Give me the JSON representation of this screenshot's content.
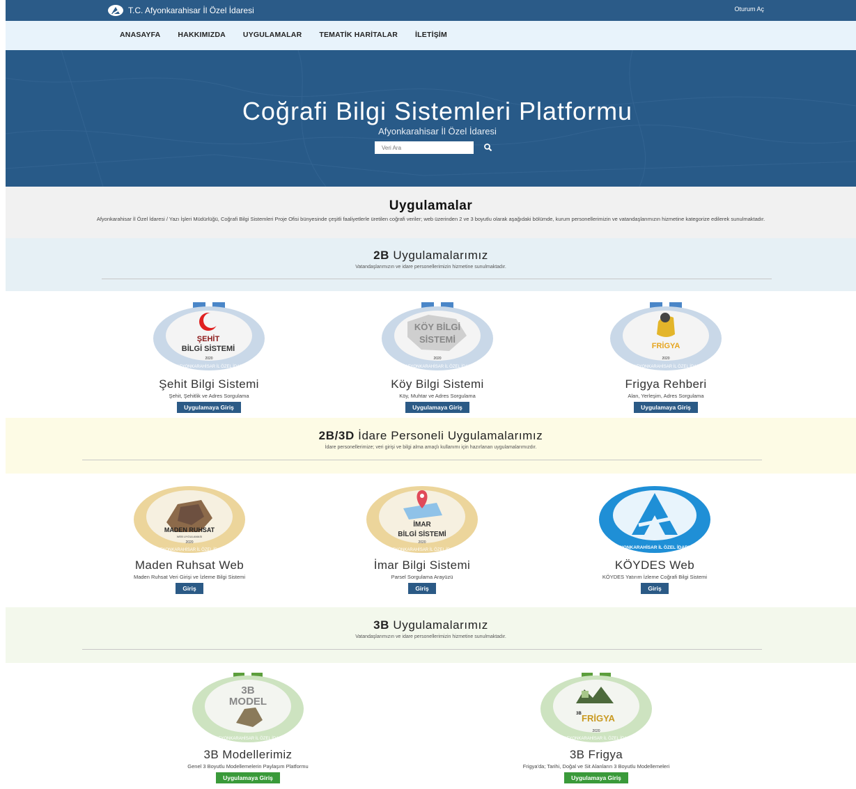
{
  "topbar": {
    "brand": "T.C. Afyonkarahisar İl Özel İdaresi",
    "login": "Oturum Aç"
  },
  "nav": [
    "ANASAYFA",
    "HAKKIMIZDA",
    "UYGULAMALAR",
    "TEMATİK HARİTALAR",
    "İLETİŞİM"
  ],
  "hero": {
    "title": "Coğrafi Bilgi Sistemleri Platformu",
    "subtitle": "Afyonkarahisar İl Özel İdaresi",
    "search_placeholder": "Veri Ara"
  },
  "apps": {
    "title": "Uygulamalar",
    "description": "Afyonkarahisar İl Özel İdaresi / Yazı İşleri Müdürlüğü, Coğrafi Bilgi Sistemleri Proje Ofisi bünyesinde çeşitli faaliyetlerle üretilen coğrafi veriler; web üzerinden 2 ve 3 boyutlu olarak aşağıdaki bölümde, kurum personellerimizin ve vatandaşlarımızın hizmetine kategorize edilerek sunulmaktadır."
  },
  "section_2b": {
    "title_bold": "2B",
    "title_rest": " Uygulamalarımız",
    "subtitle": "Vatandaşlarımızın ve idare personellerimizin hizmetine sunulmaktadır.",
    "cards": [
      {
        "title": "Şehit Bilgi Sistemi",
        "desc": "Şehit, Şehitlik ve Adres Sorgulama",
        "button": "Uygulamaya Giriş",
        "badge_line1": "ŞEHİT",
        "badge_line2": "BİLGİ SİSTEMİ",
        "ring": "T.C. AFYONKARAHİSAR İL ÖZEL İDARESİ",
        "year": "2020"
      },
      {
        "title": "Köy Bilgi Sistemi",
        "desc": "Köy, Muhtar ve Adres Sorgulama",
        "button": "Uygulamaya Giriş",
        "badge_line1": "KÖY BİLGİ",
        "badge_line2": "SİSTEMİ",
        "ring": "T.C. AFYONKARAHİSAR İL ÖZEL İDARESİ",
        "year": "2020"
      },
      {
        "title": "Frigya Rehberi",
        "desc": "Alan, Yerleşim, Adres Sorgulama",
        "button": "Uygulamaya Giriş",
        "badge_line1": "FRİGYA",
        "ring": "T.C. AFYONKARAHİSAR İL ÖZEL İDARESİ",
        "year": "2020"
      }
    ]
  },
  "section_staff": {
    "title_bold": "2B/3D",
    "title_rest": " İdare Personeli Uygulamalarımız",
    "subtitle": "İdare personellerimize; veri girişi ve bilgi alma amaçlı kullanımı için hazırlanan uygulamalarımızdır.",
    "cards": [
      {
        "title": "Maden Ruhsat Web",
        "desc": "Maden Ruhsat Veri Girişi ve İzleme Bilgi Sistemi",
        "button": "Giriş",
        "badge_line1": "MADEN RUHSAT",
        "badge_line2": "WEB UYGULAMASI",
        "ring": "T.C. AFYONKARAHİSAR İL ÖZEL İDARESİ",
        "year": "2020"
      },
      {
        "title": "İmar Bilgi Sistemi",
        "desc": "Parsel Sorgulama Arayüzü",
        "button": "Giriş",
        "badge_line1": "İMAR",
        "badge_line2": "BİLGİ SİSTEMİ",
        "ring": "T.C. AFYONKARAHİSAR İL ÖZEL İDARESİ",
        "year": "2020"
      },
      {
        "title": "KÖYDES Web",
        "desc": "KÖYDES Yatırım İzleme Coğrafi Bilgi Sistemi",
        "button": "Giriş",
        "ring": "AFYONKARAHİSAR İL ÖZEL İDARESİ"
      }
    ]
  },
  "section_3b": {
    "title_bold": "3B",
    "title_rest": " Uygulamalarımız",
    "subtitle": "Vatandaşlarımızın ve idare personellerimizin hizmetine sunulmaktadır.",
    "cards": [
      {
        "title": "3B Modellerimiz",
        "desc": "Genel 3 Boyutlu Modellemelerin Paylaşım Platformu",
        "button": "Uygulamaya Giriş",
        "badge_line1": "3B",
        "badge_line2": "MODEL",
        "ring": "T.C. AFYONKARAHİSAR İL ÖZEL İDARESİ"
      },
      {
        "title": "3B Frigya",
        "desc": "Frigya'da; Tarihi, Doğal ve Sit Alanların 3 Boyutlu Modellemeleri",
        "button": "Uygulamaya Giriş",
        "badge_line1": "3B",
        "badge_line2": "FRİGYA",
        "ring": "T.C. AFYONKARAHİSAR İL ÖZEL İDARESİ",
        "year": "2020"
      }
    ]
  },
  "colors": {
    "primary": "#2b5a86",
    "green": "#3a9a3a",
    "nav_bg": "#e8f3fb"
  }
}
